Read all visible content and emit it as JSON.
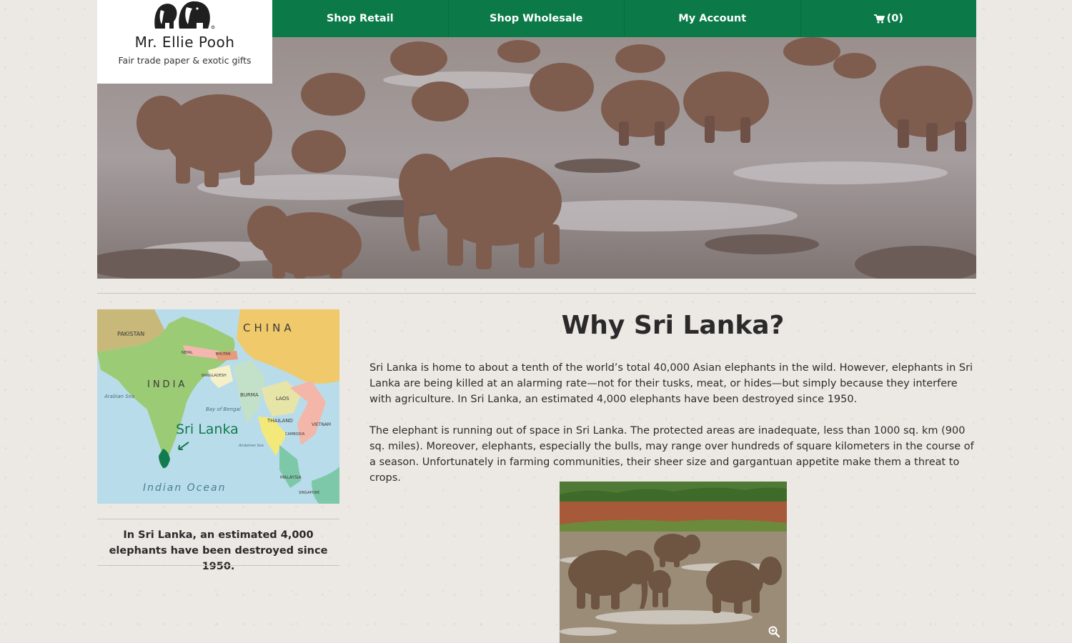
{
  "brand": {
    "name": "Mr. Ellie Pooh",
    "tagline": "Fair trade paper & exotic gifts",
    "logo_icon": "elephant-logo-icon"
  },
  "nav": {
    "items": [
      {
        "label": "Shop Retail"
      },
      {
        "label": "Shop Wholesale"
      },
      {
        "label": "My Account"
      },
      {
        "label": "(0)",
        "icon": "cart-icon"
      }
    ],
    "color": "#0b7a48"
  },
  "sidebar": {
    "map_labels": {
      "china": "CHINA",
      "india": "INDIA",
      "pakistan": "PAKISTAN",
      "nepal": "NEPAL",
      "bhutan": "BHUTAN",
      "bangladesh": "BANGLADESH",
      "burma": "BURMA",
      "laos": "LAOS",
      "thailand": "THAILAND",
      "vietnam": "VIETNAM",
      "cambodia": "CAMBODIA",
      "malaysia": "MALAYSIA",
      "singapore": "SINGAPORE",
      "arabian_sea": "Arabian Sea",
      "bay_of_bengal": "Bay of Bengal",
      "andaman_sea": "Andaman Sea",
      "indian_ocean": "Indian Ocean",
      "sri_lanka": "Sri Lanka"
    },
    "caption": "In Sri Lanka, an estimated 4,000 elephants have been destroyed since 1950."
  },
  "main": {
    "title": "Why Sri Lanka?",
    "paragraphs": [
      "Sri Lanka is home to about a tenth of the world’s total 40,000 Asian elephants in the wild. However, elephants in Sri Lanka are being killed at an alarming rate—not for their tusks, meat, or hides—but simply because they interfere with agriculture. In Sri Lanka, an estimated 4,000 elephants have been destroyed since 1950.",
      "The elephant is running out of space in Sri Lanka. The protected areas are inadequate, less than 1000 sq. km (900 sq. miles). Moreover, elephants, especially the bulls, may range over hundreds of square kilometers in the course of a season. Unfortunately in farming communities, their sheer size and gargantuan appetite make them a threat to crops."
    ],
    "photo_icon": "zoom-icon"
  }
}
